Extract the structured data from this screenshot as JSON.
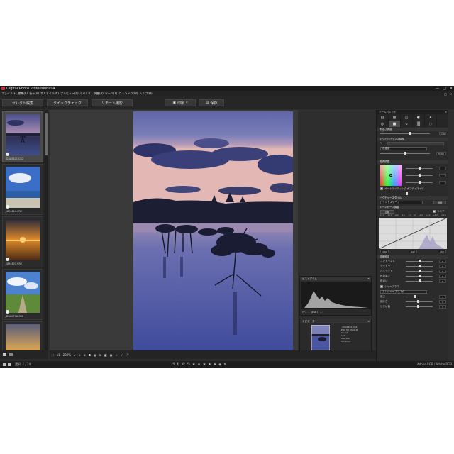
{
  "window": {
    "title": "Digital Photo Professional 4",
    "controls": [
      "—",
      "□",
      "✕"
    ]
  },
  "menu": {
    "items": [
      "ファイル(F)",
      "編集(E)",
      "表示(V)",
      "サムネイル(N)",
      "プレビュー(P)",
      "ラベル(L)",
      "調整(A)",
      "ツール(T)",
      "ウィンドウ(W)",
      "ヘルプ(H)"
    ],
    "right": [
      "—",
      "□",
      "✕"
    ]
  },
  "toolbar": {
    "select_edit": "セレクト編集",
    "quick_check": "クイックチェック",
    "remote_shoot": "リモート撮影",
    "print": "印刷",
    "save": "保存"
  },
  "thumbnails": [
    {
      "file": "_D3A0821.CR2",
      "selected": true
    },
    {
      "file": "_4M4414.CR2",
      "selected": false
    },
    {
      "file": "_4M4457.CR2",
      "selected": false
    },
    {
      "file": "_D3A0756.CR2",
      "selected": false
    },
    {
      "file": "",
      "selected": false
    }
  ],
  "viewbar": {
    "zoom": "200%",
    "zoom_x1": "x1"
  },
  "histogram_panel": {
    "title": "ヒストグラム",
    "footer": "YY ( . . . )RGB ( . . . )"
  },
  "navigator_panel": {
    "title": "ナビゲーター",
    "info_lines": [
      "_D3A0821.CR2",
      "EOS 5D Mark III",
      "Av 8.0",
      "1/4",
      "ISO 100",
      "50.0mm"
    ]
  },
  "palette": {
    "title": "ツールパレット",
    "brightness": {
      "label": "明るさ調整",
      "value": "0.00"
    },
    "wb": {
      "label": "ホワイトバランス調整",
      "mode": "色温度",
      "value": "5200"
    },
    "tone": {
      "label": "階調調整",
      "auto_label": "オートライティングオプティマイザ"
    },
    "picture_style": {
      "label": "ピクチャースタイル",
      "style": "ランドスケープ",
      "detail": "詳細"
    },
    "tone_curve": {
      "label": "トーンカーブ調整",
      "mode": "自動",
      "linear": "リニア",
      "input": "239",
      "output": "142",
      "point": "255",
      "scale": [
        "-18.0",
        "-12.0",
        "-6.0",
        "-4.0",
        "-2.0",
        "0",
        "+2.0",
        "+4.0",
        "+6.0",
        "+12.0"
      ]
    },
    "detail": {
      "label": "詳細設定",
      "rows": [
        {
          "label": "コントラスト",
          "value": "0"
        },
        {
          "label": "シャドウ",
          "value": "0"
        },
        {
          "label": "ハイライト",
          "value": "0"
        },
        {
          "label": "色の濃さ",
          "value": "0"
        },
        {
          "label": "色合い",
          "value": "0"
        }
      ]
    },
    "sharpness": {
      "label": "シャープネス",
      "mode": "アンシャープマスク",
      "rows": [
        {
          "label": "強さ",
          "value": "3"
        },
        {
          "label": "細かさ",
          "value": "4"
        },
        {
          "label": "しきい値",
          "value": "4"
        }
      ]
    }
  },
  "status": {
    "count": "選択: 1 / 24",
    "color_space": "Adobe RGB / Adobe RGB"
  }
}
